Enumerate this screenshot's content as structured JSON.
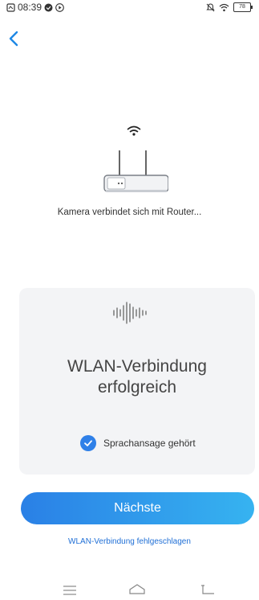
{
  "status_bar": {
    "time": "08:39",
    "battery": "78"
  },
  "router": {
    "connecting_text": "Kamera verbindet sich mit Router..."
  },
  "card": {
    "title_line1": "WLAN-Verbindung",
    "title_line2": "erfolgreich",
    "checkbox_label": "Sprachansage gehört",
    "checkbox_checked": true
  },
  "actions": {
    "next_label": "Nächste",
    "fail_link": "WLAN-Verbindung fehlgeschlagen"
  },
  "colors": {
    "accent": "#2f80e8",
    "card_bg": "#f3f4f6",
    "back_arrow": "#1e88e5"
  }
}
